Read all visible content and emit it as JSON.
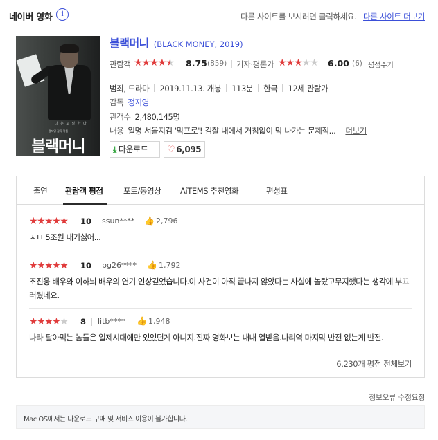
{
  "header": {
    "brand": "네이버 영화",
    "info_icon": "i",
    "other_site_text": "다른 사이트를 보시려면 클릭하세요.",
    "other_site_link": "다른 사이트 더보기"
  },
  "poster": {
    "title_text": "블랙머니",
    "tagline": "나 는  고 발 한 다",
    "label": "정지영 감독 작품"
  },
  "movie": {
    "title": "블랙머니",
    "subtitle": "(BLACK MONEY, 2019)",
    "audience_label": "관람객",
    "audience_score": "8.75",
    "audience_count": "(859)",
    "audience_stars_on": "★★★★",
    "audience_stars_half": "★",
    "critic_label": "기자·평론가",
    "critic_score": "6.00",
    "critic_count": "(6)",
    "critic_stars_on": "★★★",
    "critic_stars_off": "★★",
    "rate_link": "평점주기",
    "genre": "범죄, 드라마",
    "release": "2019.11.13. 개봉",
    "runtime": "113분",
    "country": "한국",
    "age": "12세 관람가",
    "director_label": "감독",
    "director": "정지영",
    "attendance_label": "관객수",
    "attendance": "2,480,145명",
    "synopsis_label": "내용",
    "synopsis": "일명 서울지검 '막프로'! 검찰 내에서 거침없이 막 나가는 문제적...",
    "more_link": "더보기"
  },
  "actions": {
    "download_label": "다운로드",
    "like_count": "6,095"
  },
  "tabs": [
    {
      "label": "출연"
    },
    {
      "label": "관람객 평점"
    },
    {
      "label": "포토/동영상"
    },
    {
      "label": "AiTEMS 추천영화"
    },
    {
      "label": "편성표"
    }
  ],
  "reviews": [
    {
      "stars_on": "★★★★★",
      "stars_off": "",
      "score": "10",
      "user": "ssun****",
      "likes": "2,796",
      "text": "ㅅㅂ 5조원 내기싫어..."
    },
    {
      "stars_on": "★★★★★",
      "stars_off": "",
      "score": "10",
      "user": "bg26****",
      "likes": "1,792",
      "text": "조진웅 배우와 이하늬 배우의 연기 인상깊었습니다.이 사건이 아직 끝나지 않았다는 사실에 놀랐고무지했다는 생각에 부끄러웠네요."
    },
    {
      "stars_on": "★★★★",
      "stars_off": "★",
      "score": "8",
      "user": "litb****",
      "likes": "1,948",
      "text": "나라 팔아먹는 놈들은 일제시대에만 있었던게 아니지.진짜 영화보는 내내 열받음.나리역 마지막 반전 없는게 반전."
    }
  ],
  "all_reviews_link": "6,230개 평점 전체보기",
  "error_report_link": "정보오류 수정요청",
  "notice_text": "Mac OS에서는 다운로드 구매 및 서비스 이용이 불가합니다.",
  "colors": {
    "accent": "#3b4fd8",
    "star": "#e03b3b",
    "download": "#2ea33a"
  }
}
